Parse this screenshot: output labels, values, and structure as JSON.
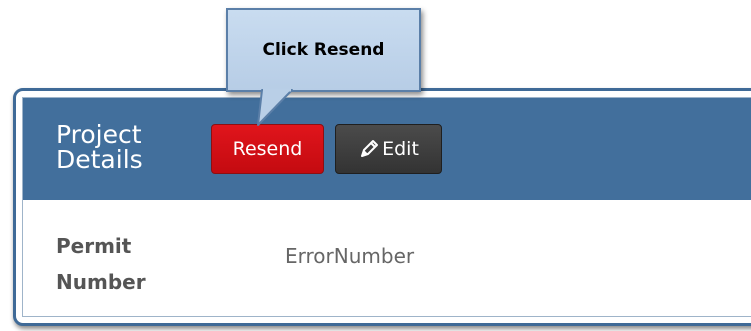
{
  "callout": {
    "text": "Click Resend"
  },
  "panel": {
    "title": "Project Details",
    "buttons": {
      "resend_label": "Resend",
      "edit_label": "Edit",
      "edit_icon": "pencil-icon"
    },
    "fields": [
      {
        "label": "Permit Number",
        "value": "ErrorNumber"
      }
    ]
  },
  "colors": {
    "header_bg": "#426f9c",
    "resend_bg": "#d60f16",
    "edit_bg": "#3c3c3c",
    "callout_bg": "#c2d6ec"
  }
}
